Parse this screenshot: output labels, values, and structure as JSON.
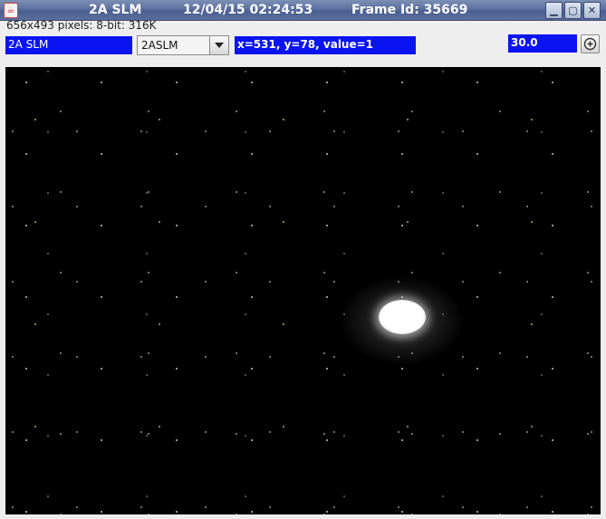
{
  "window": {
    "title_name": "2A SLM",
    "title_timestamp": "12/04/15 02:24:53",
    "title_frame": "Frame Id: 35669",
    "minimize_icon": "minimize-icon",
    "maximize_icon": "maximize-icon",
    "close_icon": "close-icon"
  },
  "image_info": "656x493 pixels: 8-bit: 316K",
  "toolbar": {
    "camera_name": "2A SLM",
    "camera_select": {
      "selected": "2ASLM"
    },
    "cursor_readout": "x=531, y=78, value=1",
    "scale_value": "30.0",
    "zoom_icon": "zoom-in-icon"
  },
  "colors": {
    "field_blue": "#0a14f0",
    "title_bar": "#5d71a0",
    "image_background": "#000000"
  }
}
